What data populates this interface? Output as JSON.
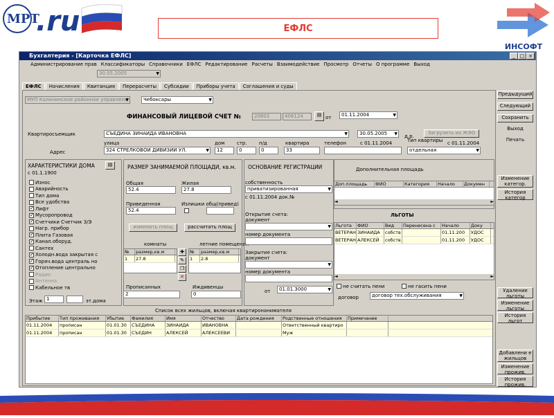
{
  "header": {
    "title": "ЕФЛС",
    "logo_left_text": "ru",
    "logo_right_text": "ИНСОФТ"
  },
  "window": {
    "title": "Бухгалтерия - [Карточка ЕФЛС]",
    "controls": [
      "_",
      "□",
      "×"
    ]
  },
  "menu": [
    "Администрирование прав",
    "Классификаторы",
    "Справочники",
    "ЕФЛС",
    "Редактирование",
    "Расчеты",
    "Взаимодействие",
    "Просмотр",
    "Отчеты",
    "О программе",
    "Выход"
  ],
  "toolbar": {
    "date": "30.05.2005"
  },
  "tabs": [
    "ЕФЛС",
    "Начисления",
    "Квитанция",
    "Перерасчеты",
    "Субсидии",
    "Приборы учета",
    "Соглашения и суды"
  ],
  "top": {
    "org": "МУП Калининское районное управлени",
    "city": "Чебоксары"
  },
  "account": {
    "label": "ФИНАНСОВЫЙ ЛИЦЕВОЙ СЧЕТ №",
    "num1": "20802",
    "num2": "406124",
    "from_label": "от",
    "date": "01.11.2004"
  },
  "tenant": {
    "label": "Квартиросъемщик",
    "name": "СЪЕДИНА ЗИНАИДА ИВАНОВНА",
    "date": "30.05.2005",
    "dr_label": "д.р.",
    "transfer_btn": "Загрузить из ЖЭО"
  },
  "address": {
    "label": "Адрес",
    "street_label": "улица",
    "street": "324 СТРЕЛКОВОЙ ДИВИЗИИ УЛ.",
    "house_label": "дом",
    "house": "12",
    "building_label": "стр.",
    "building": "0",
    "entrance_label": "п/д",
    "entrance": "0",
    "apt_label": "квартира",
    "apt": "33",
    "phone_label": "телефон",
    "since": "с 01.11.2004",
    "apt_type_label": "Тип квартиры",
    "apt_type_since": "с 01.11.2004",
    "apt_type": "отдельная"
  },
  "characteristics": {
    "title": "ХАРАКТЕРИСТИКИ ДОМА",
    "since": "с 01.1.1900",
    "items": [
      {
        "label": "Износ",
        "checked": false,
        "disabled": false
      },
      {
        "label": "Аварийность",
        "checked": false,
        "disabled": false
      },
      {
        "label": "Тип дома",
        "checked": false,
        "disabled": false
      },
      {
        "label": "Все удобства",
        "checked": false,
        "disabled": false
      },
      {
        "label": "Лифт",
        "checked": true,
        "disabled": false
      },
      {
        "label": "Мусоропровод",
        "checked": true,
        "disabled": false
      },
      {
        "label": "Счетчики  Счетчик З/Э",
        "checked": true,
        "disabled": false
      },
      {
        "label": "Нагр. прибор",
        "checked": false,
        "disabled": false
      },
      {
        "label": "Плита   Газовая",
        "checked": true,
        "disabled": false
      },
      {
        "label": "Канал.оборуд.",
        "checked": true,
        "disabled": false
      },
      {
        "label": "Сантех",
        "checked": false,
        "disabled": false
      },
      {
        "label": "Холодн.вода  закрытая с",
        "checked": true,
        "disabled": false
      },
      {
        "label": "Горяч.вода  централь но",
        "checked": true,
        "disabled": false
      },
      {
        "label": "Отопление  центрально",
        "checked": true,
        "disabled": false
      },
      {
        "label": "Радио",
        "checked": false,
        "disabled": true
      },
      {
        "label": "Антенна",
        "checked": false,
        "disabled": true
      },
      {
        "label": "Кабельное тв",
        "checked": false,
        "disabled": false
      }
    ],
    "floor_label": "Этаж",
    "floor": "1",
    "floors_label": "эт.дома"
  },
  "area": {
    "title": "РАЗМЕР ЗАНИМАЕМОЙ ПЛОЩАДИ, кв.м.",
    "total_label": "Общая",
    "total": "52.4",
    "living_label": "Жилая",
    "living": "27.8",
    "given_label": "Приведенная",
    "given": "52.4",
    "excess_label": "Излишки общ(привед)",
    "change_btn": "изменить площ",
    "calc_btn": "рассчитать площ",
    "rooms_label": "комнаты",
    "summer_label": "летние помещения",
    "rooms_cols": [
      "№",
      "размер,кв.м"
    ],
    "rooms_rows": [
      [
        "1",
        "27.8"
      ]
    ],
    "summer_cols": [
      "№",
      "размер,кв.м"
    ],
    "summer_rows": [
      [
        "1",
        "2.8"
      ]
    ],
    "registered_label": "Прописанных",
    "registered": "2",
    "dependents_label": "Иждивенцы",
    "dependents": "0"
  },
  "registration": {
    "title": "ОСНОВАНИЕ РЕГИСТРАЦИИ",
    "ownership_label": "собственность",
    "ownership": "приватизированная",
    "since": "с 01.11.2004 док.№",
    "open_label": "Открытие счета: документ",
    "open_num_label": "номер документа",
    "close_label": "Закрытие счета: документ",
    "close_num_label": "номер документа",
    "from_label": "от",
    "from_date": "01.01.3000"
  },
  "extra_area": {
    "title": "Дополнительная площадь",
    "cols": [
      "Доп.площадь",
      "ФИО",
      "Категория",
      "Начало",
      "Докумен"
    ]
  },
  "privileges": {
    "title": "ЛЬГОТЫ",
    "cols": [
      "Льгота",
      "ФИО",
      "Вид",
      "Перенесена с",
      "Начало",
      "Доку"
    ],
    "rows": [
      [
        "ВЕТЕРАН",
        "ЗИНАИДА",
        "собств",
        "",
        "01.11.200",
        "УДОС"
      ],
      [
        "ВЕТЕРАН",
        "АЛЕКСЕЙ",
        "собств",
        "",
        "01.11.200",
        "УДОС"
      ]
    ]
  },
  "penalty": {
    "no_penalty": "не считать пени",
    "no_repay": "не гасить пени",
    "contract_label": "договор",
    "contract": "договор тех.обслуживания"
  },
  "residents": {
    "title": "Список всех жильцов, включая квартиронанимателя",
    "cols": [
      "Прибытие",
      "Тип проживания",
      "Убытие",
      "Фамилия",
      "Имя",
      "Отчество",
      "Дата рождения",
      "Родственные отношения",
      "Примечание"
    ],
    "rows": [
      [
        "01.11.2004",
        "прописан",
        "01.01.30",
        "СЪЕДИНА",
        "ЗИНАИДА",
        "ИВАНОВНА",
        "",
        "Ответственный квартиро",
        ""
      ],
      [
        "01.11.2004",
        "прописан",
        "01.01.30",
        "СЪЕДИН",
        "АЛЕКСЕЙ",
        "АЛЕКСЕЕВИ",
        "",
        "Муж",
        ""
      ]
    ]
  },
  "side_buttons": {
    "prev": "Предыдущий",
    "next": "Следующий",
    "save": "Сохранить",
    "exit": "Выход",
    "print": "Печать",
    "change_cat": "Изменение категор.",
    "history_cat": "История категор",
    "del_priv": "Удаление льготы",
    "change_priv": "Изменение льготы",
    "history_priv": "История льгот",
    "add_res": "Добавлени е жильцов",
    "change_res": "Изменение прожив.",
    "history_res": "История прожив."
  }
}
